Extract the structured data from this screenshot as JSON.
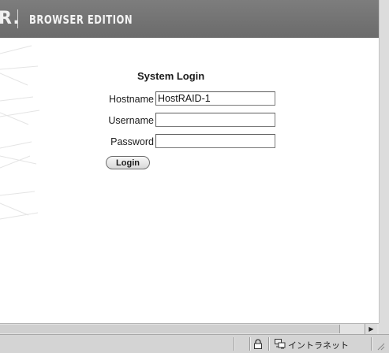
{
  "header": {
    "brand_tail": "R.",
    "edition": "BROWSER EDITION"
  },
  "login": {
    "title": "System Login",
    "fields": [
      {
        "label": "Hostname",
        "value": "HostRAID-1"
      },
      {
        "label": "Username",
        "value": ""
      },
      {
        "label": "Password",
        "value": ""
      }
    ],
    "button_label": "Login"
  },
  "statusbar": {
    "zone_label": "イントラネット",
    "icons": [
      "lock-icon",
      "intranet-zone-icon",
      "resize-grip-icon"
    ]
  },
  "scrollbar": {
    "icons": [
      "scroll-right-arrow-icon"
    ]
  },
  "colors": {
    "header_bg": "#737373",
    "header_text": "#f2f2f2",
    "chrome": "#d4d4d4"
  }
}
